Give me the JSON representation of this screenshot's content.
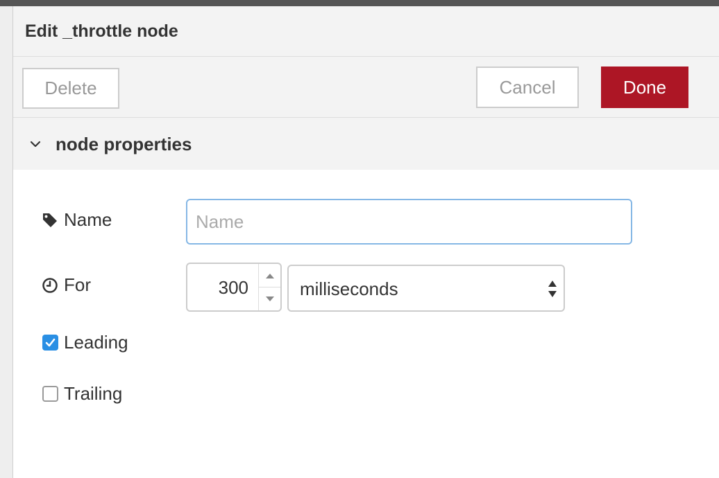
{
  "tray": {
    "title": "Edit _throttle node"
  },
  "toolbar": {
    "delete_label": "Delete",
    "cancel_label": "Cancel",
    "done_label": "Done"
  },
  "section": {
    "title": "node properties",
    "icon": "chevron-down-icon"
  },
  "form": {
    "name": {
      "label": "Name",
      "icon": "tag-icon",
      "value": "",
      "placeholder": "Name"
    },
    "for": {
      "label": "For",
      "icon": "clock-icon",
      "value": "300",
      "unit": "milliseconds"
    },
    "leading": {
      "label": "Leading",
      "checked": true
    },
    "trailing": {
      "label": "Trailing",
      "checked": false
    }
  },
  "colors": {
    "accent": "#ad1625",
    "focus_border": "#85b7e5",
    "checkbox_checked": "#2a8fe4"
  }
}
